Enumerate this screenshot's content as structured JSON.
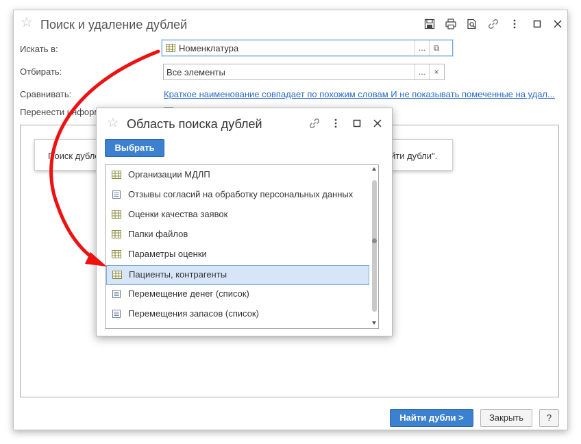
{
  "main_window": {
    "title": "Поиск и удаление дублей",
    "form": {
      "search_in_label": "Искать в:",
      "search_in_value": "Номенклатура",
      "filter_label": "Отбирать:",
      "filter_value": "Все элементы",
      "compare_label": "Сравнивать:",
      "compare_link": "Краткое наименование совпадает по похожим словам И не показывать помеченные на удал...",
      "transfer_label": "Перенести информ",
      "select_btn_label": "...",
      "open_btn_label": "⧉",
      "clear_btn_label": "×"
    },
    "info": {
      "left_text": "Поиск дубле",
      "right_text": "йти дубли\"."
    },
    "footer": {
      "find_button": "Найти дубли >",
      "close_button": "Закрыть",
      "help_button": "?"
    }
  },
  "dialog": {
    "title": "Область поиска дублей",
    "select_button": "Выбрать",
    "items": [
      {
        "label": "Организации МДЛП",
        "icon": "table-icon"
      },
      {
        "label": "Отзывы согласий на обработку персональных данных",
        "icon": "document-icon"
      },
      {
        "label": "Оценки качества заявок",
        "icon": "table-icon"
      },
      {
        "label": "Папки файлов",
        "icon": "table-icon"
      },
      {
        "label": "Параметры оценки",
        "icon": "table-icon"
      },
      {
        "label": "Пациенты, контрагенты",
        "icon": "table-icon",
        "selected": true
      },
      {
        "label": "Перемещение денег (список)",
        "icon": "document-icon"
      },
      {
        "label": "Перемещения запасов (список)",
        "icon": "document-icon"
      }
    ]
  },
  "colors": {
    "accent": "#3c81cf",
    "link": "#2a6ac5",
    "selection": "#d6e6f8",
    "arrow": "#ee1111"
  }
}
